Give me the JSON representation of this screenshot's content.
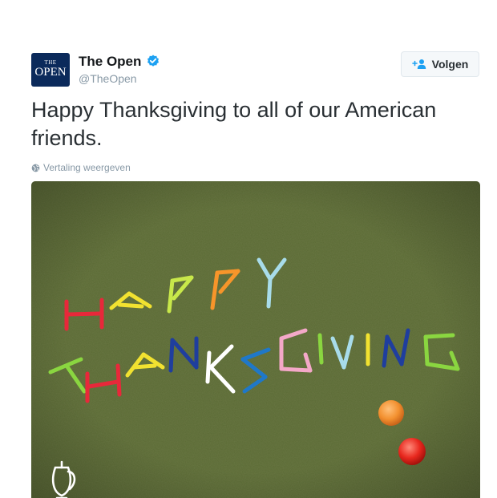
{
  "tweet": {
    "author": {
      "display_name": "The Open",
      "handle": "@TheOpen",
      "avatar_text_small": "THE",
      "avatar_text_big": "OPEN",
      "verified": true
    },
    "follow_button": {
      "label": "Volgen",
      "icon": "add-user-icon"
    },
    "text": "Happy Thanksgiving to all of our American friends.",
    "translate_link": {
      "label": "Vertaling weergeven",
      "icon": "globe-icon"
    },
    "media": {
      "image_text_line1": "HAPPY",
      "image_text_line2": "THANKSGIVING",
      "watermark_icon": "claret-jug-logo-icon"
    }
  },
  "colors": {
    "text": "#292f33",
    "secondary_text": "#8899a6",
    "verified_blue": "#1da1f2",
    "button_bg": "#f5f8fa",
    "button_border": "#e1e8ed",
    "grass": "#5a6a34",
    "avatar_bg": "#0b2a5b"
  }
}
